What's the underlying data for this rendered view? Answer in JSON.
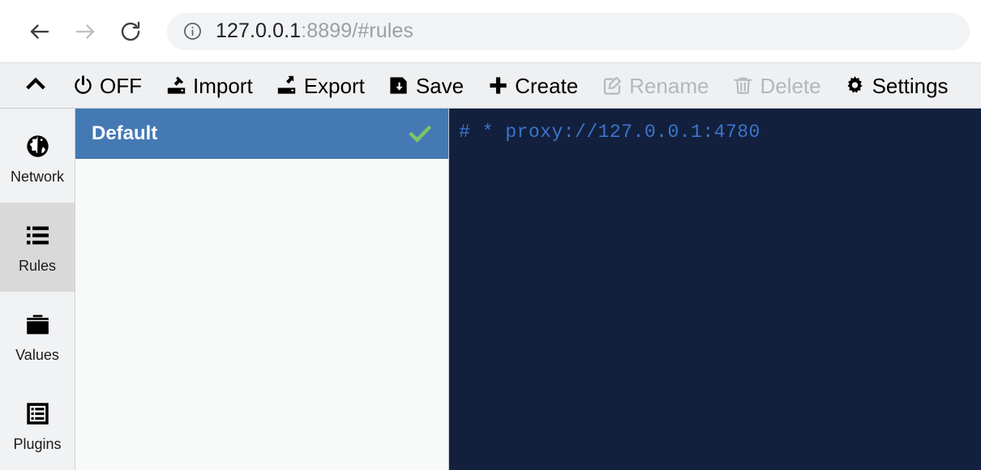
{
  "browser": {
    "back_icon": "arrow-left-icon",
    "forward_icon": "arrow-right-icon",
    "reload_icon": "reload-icon",
    "site_info_icon": "info-circle-icon",
    "url_host": "127.0.0.1",
    "url_rest": ":8899/#rules",
    "url_full": "127.0.0.1:8899/#rules"
  },
  "toolbar": {
    "collapse_icon": "chevron-up-icon",
    "items": [
      {
        "label": "OFF",
        "icon": "power-icon",
        "enabled": true
      },
      {
        "label": "Import",
        "icon": "import-icon",
        "enabled": true
      },
      {
        "label": "Export",
        "icon": "export-icon",
        "enabled": true
      },
      {
        "label": "Save",
        "icon": "save-icon",
        "enabled": true
      },
      {
        "label": "Create",
        "icon": "plus-icon",
        "enabled": true
      },
      {
        "label": "Rename",
        "icon": "edit-icon",
        "enabled": false
      },
      {
        "label": "Delete",
        "icon": "trash-icon",
        "enabled": false
      },
      {
        "label": "Settings",
        "icon": "gear-icon",
        "enabled": true
      }
    ]
  },
  "sidebar": {
    "items": [
      {
        "label": "Network",
        "icon": "globe-icon",
        "active": false
      },
      {
        "label": "Rules",
        "icon": "list-icon",
        "active": true
      },
      {
        "label": "Values",
        "icon": "folder-icon",
        "active": false
      },
      {
        "label": "Plugins",
        "icon": "plugin-icon",
        "active": false
      }
    ]
  },
  "rules_list": {
    "rows": [
      {
        "name": "Default",
        "selected": true,
        "enabled_icon": "check-icon"
      }
    ]
  },
  "editor": {
    "lines": [
      "# * proxy://127.0.0.1:4780"
    ],
    "line_1": "# * proxy://127.0.0.1:4780"
  },
  "colors": {
    "selection_blue": "#4479b4",
    "check_green": "#7dc36a",
    "editor_background": "#12203d",
    "editor_text": "#3d74cc",
    "toolbar_background": "#eef0f2",
    "sidebar_active": "#d9d9d9",
    "disabled_text": "#b5b7ba"
  }
}
